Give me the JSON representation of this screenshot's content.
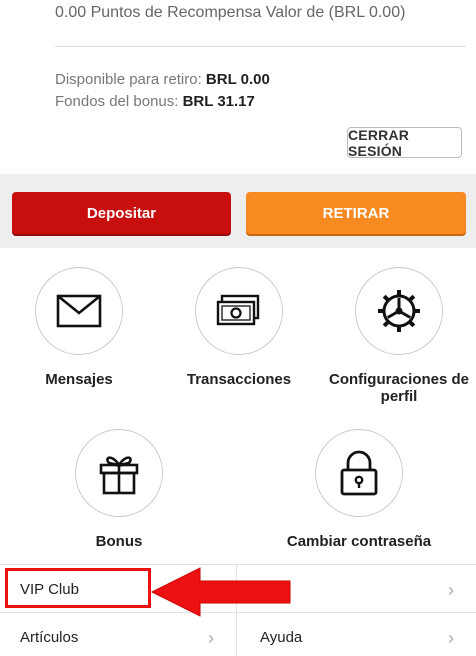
{
  "account": {
    "points_text": "0.00 Puntos de Recompensa Valor de (BRL 0.00)",
    "withdraw_available_label": "Disponible para retiro:",
    "withdraw_available_value": "BRL 0.00",
    "bonus_funds_label": "Fondos del bonus:",
    "bonus_funds_value": "BRL 31.17",
    "logout_label": "CERRAR SESIÓN"
  },
  "actions": {
    "deposit_label": "Depositar",
    "withdraw_label": "RETIRAR",
    "deposit_color": "#c90e0e",
    "withdraw_color": "#f88a22"
  },
  "shortcuts": [
    {
      "label": "Mensajes",
      "icon": "envelope-icon"
    },
    {
      "label": "Transacciones",
      "icon": "money-icon"
    },
    {
      "label": "Configuraciones de perfil",
      "icon": "settings-icon"
    },
    {
      "label": "Bonus",
      "icon": "gift-icon"
    },
    {
      "label": "Cambiar contraseña",
      "icon": "lock-icon"
    }
  ],
  "menu": {
    "vip_label": "VIP Club",
    "articles_label": "Artículos",
    "help_label": "Ayuda"
  },
  "annotation": {
    "highlight_color": "#ee1111"
  }
}
